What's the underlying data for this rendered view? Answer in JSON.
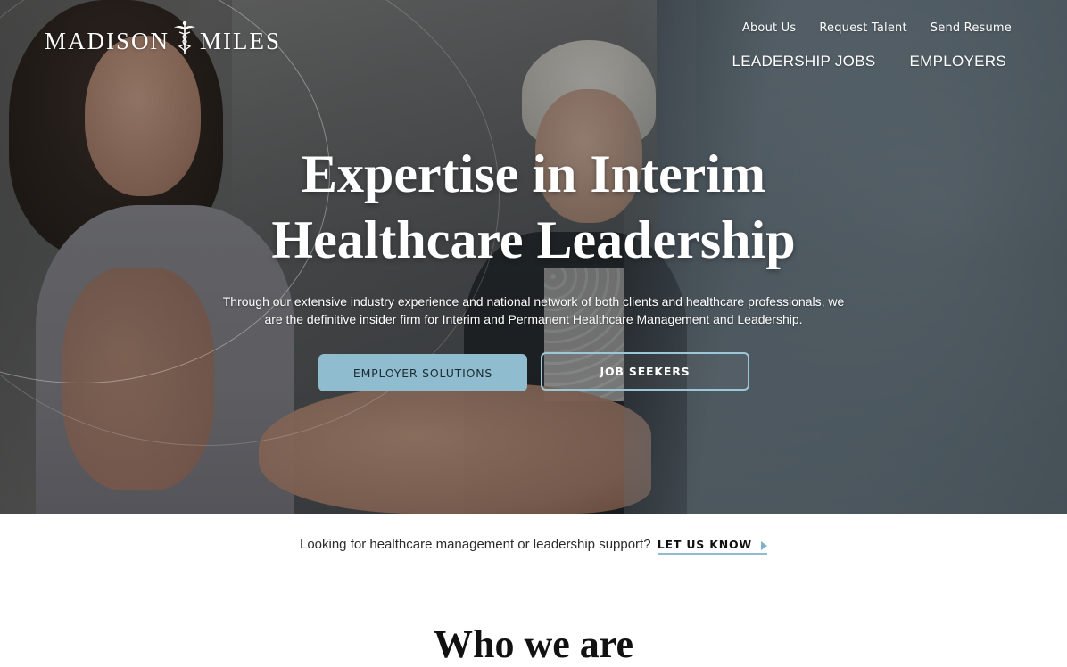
{
  "brand": {
    "name_left": "MADISON",
    "name_right": "MILES",
    "logo_icon": "caduceus-icon"
  },
  "utility_nav": [
    "About Us",
    "Request Talent",
    "Send Resume"
  ],
  "main_nav": [
    "LEADERSHIP JOBS",
    "EMPLOYERS"
  ],
  "hero": {
    "title_line1": "Expertise in Interim",
    "title_line2": "Healthcare Leadership",
    "subtitle_line1": "Through our extensive industry experience and national network of both clients and healthcare professionals, we",
    "subtitle_line2": "are the definitive insider firm for Interim and Permanent Healthcare Management and Leadership.",
    "primary_button": "EMPLOYER SOLUTIONS",
    "secondary_button": "JOB SEEKERS"
  },
  "cta": {
    "text": "Looking for healthcare management or leadership support?",
    "link": "LET US KNOW"
  },
  "next_section": {
    "heading": "Who we are"
  },
  "colors": {
    "accent": "#8fbcce",
    "accent_border": "#9cc7d8",
    "text_dark": "#2b2b2b"
  }
}
